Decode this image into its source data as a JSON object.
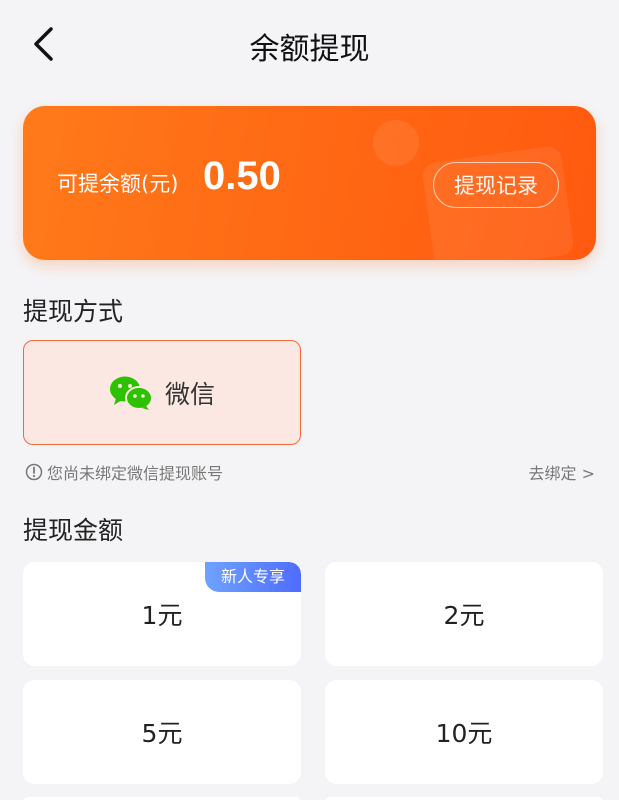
{
  "header": {
    "title": "余额提现",
    "back_icon": "chevron-left-icon"
  },
  "balance": {
    "label": "可提余额(元)",
    "value": "0.50",
    "history_button": "提现记录",
    "card_color": "#ff6a14"
  },
  "withdraw_method": {
    "section_title": "提现方式",
    "options": [
      {
        "label": "微信",
        "icon": "wechat-icon",
        "selected": true
      }
    ],
    "notice": "您尚未绑定微信提现账号",
    "notice_icon": "info-icon",
    "bind_link": "去绑定 >"
  },
  "withdraw_amount": {
    "section_title": "提现金额",
    "options": [
      {
        "label": "1元",
        "badge": "新人专享"
      },
      {
        "label": "2元"
      },
      {
        "label": "5元"
      },
      {
        "label": "10元"
      }
    ]
  },
  "colors": {
    "accent": "#ff6a14",
    "selected_border": "#f26a3a",
    "selected_bg": "#fbe8e3",
    "badge": "#5b7fff",
    "background": "#f4f4f6"
  }
}
